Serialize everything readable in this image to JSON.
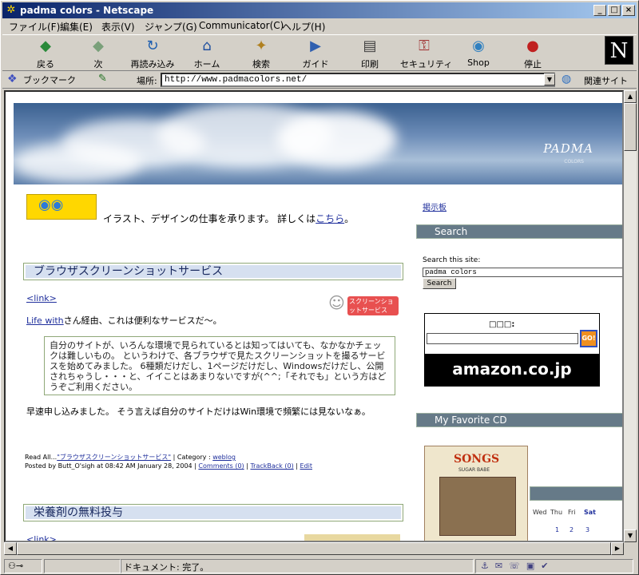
{
  "window": {
    "title": "padma colors - Netscape"
  },
  "menu": [
    "ファイル(F)",
    "編集(E)",
    "表示(V)",
    "ジャンプ(G)",
    "Communicator(C)",
    "ヘルプ(H)"
  ],
  "toolbar": [
    {
      "label": "戻る",
      "icon": "back-arrow-icon",
      "glyph": "◆",
      "color": "#2a8a3a"
    },
    {
      "label": "次",
      "icon": "forward-arrow-icon",
      "glyph": "◆",
      "color": "#7aa07a"
    },
    {
      "label": "再読み込み",
      "icon": "reload-icon",
      "glyph": "↻",
      "color": "#2060b0"
    },
    {
      "label": "ホーム",
      "icon": "home-icon",
      "glyph": "⌂",
      "color": "#2050a0"
    },
    {
      "label": "検索",
      "icon": "search-icon",
      "glyph": "✦",
      "color": "#b08020"
    },
    {
      "label": "ガイド",
      "icon": "guide-icon",
      "glyph": "▶",
      "color": "#3060b0"
    },
    {
      "label": "印刷",
      "icon": "print-icon",
      "glyph": "▤",
      "color": "#404040"
    },
    {
      "label": "セキュリティ",
      "icon": "lock-icon",
      "glyph": "⚿",
      "color": "#a03030"
    },
    {
      "label": "Shop",
      "icon": "shop-icon",
      "glyph": "◉",
      "color": "#3080c0"
    },
    {
      "label": "停止",
      "icon": "stop-icon",
      "glyph": "●",
      "color": "#c02020"
    }
  ],
  "location": {
    "bookmark": "ブックマーク",
    "label": "場所:",
    "url": "http://www.padmacolors.net/",
    "related": "関連サイト"
  },
  "status": {
    "text": "ドキュメント: 完了。"
  },
  "page": {
    "logo": "PADMA",
    "logo_sub": "COLORS",
    "promo": {
      "text": "イラスト、デザインの仕事を承ります。 詳しくは",
      "link": "こちら",
      "end": "。"
    },
    "post1": {
      "title": "ブラウザスクリーンショットサービス",
      "badge": "スクリーンショットサービス",
      "link": "<link>",
      "intro_link": "Life with",
      "intro": "さん経由、これは便利なサービスだ〜。",
      "quote": "自分のサイトが、いろんな環境で見られているとは知ってはいても、なかなかチェックは難しいもの。 というわけで、各ブラウザで見たスクリーンショットを撮るサービスを始めてみました。 6種類だけだし、1ページだけだし、Windowsだけだし、公開されちゃうし・・・と、イイことはあまりないですが(^^;「それでも」という方はどうぞご利用ください。",
      "body": "早速申し込みました。 そう言えば自分のサイトだけはWin環境で頻繁には見ないなぁ。",
      "readall": "Read All...",
      "readall_link": "\"ブラウザスクリーンショットサービス\"",
      "category_label": " | Category : ",
      "category": "weblog",
      "posted": "Posted by Butt_O'sigh at 08:42 AM January 28, 2004 | ",
      "comments": "Comments (0)",
      "trackback": "TrackBack (0)",
      "edit": "Edit"
    },
    "post2": {
      "title": "栄養剤の無料投与",
      "link": "<link>"
    },
    "sidebar": {
      "bbs": "掲示板",
      "search_head": "Search",
      "search_label": "Search this site:",
      "search_value": "padma colors",
      "search_button": "Search",
      "amazon_label": "□□□:",
      "amazon_go": "GO!",
      "amazon_brand": "amazon.co.jp",
      "cd_head": "My Favorite CD",
      "cd_title": "SONGS",
      "cd_artist": "SUGAR BABE",
      "cal_days": [
        "Wed",
        "Thu",
        "Fri",
        "Sat"
      ],
      "cal_dates": [
        "1",
        "2",
        "3"
      ]
    }
  }
}
